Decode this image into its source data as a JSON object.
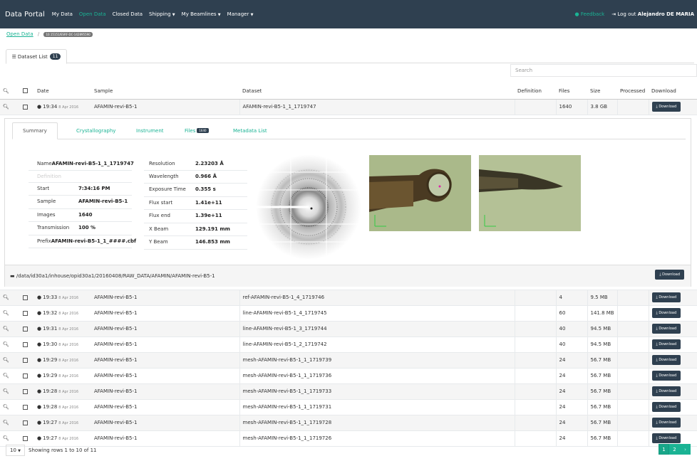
{
  "nav": {
    "brand": "Data Portal",
    "items": [
      {
        "label": "My Data",
        "active": false,
        "dropdown": false
      },
      {
        "label": "Open Data",
        "active": true,
        "dropdown": false
      },
      {
        "label": "Closed Data",
        "active": false,
        "dropdown": false
      },
      {
        "label": "Shipping",
        "active": false,
        "dropdown": true
      },
      {
        "label": "My Beamlines",
        "active": false,
        "dropdown": true
      },
      {
        "label": "Manager",
        "active": false,
        "dropdown": true
      }
    ],
    "feedback": "Feedback",
    "logout": "Log out",
    "user": "Alejandro DE MARIA"
  },
  "breadcrumb": {
    "root": "Open Data",
    "separator": "/",
    "doi": "10.15151/ESRF-DC-142895590"
  },
  "dataset_tab": {
    "label": "Dataset List",
    "count": "11"
  },
  "search": {
    "placeholder": "Search"
  },
  "table": {
    "headers": {
      "date": "Date",
      "sample": "Sample",
      "dataset": "Dataset",
      "definition": "Definition",
      "files": "Files",
      "size": "Size",
      "processed": "Processed",
      "download": "Download"
    },
    "download_label": "Download",
    "expanded_row": {
      "time": "19:34",
      "date": "8 Apr 2016",
      "sample": "AFAMIN-revi-B5-1",
      "dataset": "AFAMIN-revi-B5-1_1_1719747",
      "definition": "",
      "files": "1640",
      "size": "3.8 GB"
    },
    "rows": [
      {
        "time": "19:33",
        "date": "8 Apr 2016",
        "sample": "AFAMIN-revi-B5-1",
        "dataset": "ref-AFAMIN-revi-B5-1_4_1719746",
        "files": "4",
        "size": "9.5 MB"
      },
      {
        "time": "19:32",
        "date": "8 Apr 2016",
        "sample": "AFAMIN-revi-B5-1",
        "dataset": "line-AFAMIN-revi-B5-1_4_1719745",
        "files": "60",
        "size": "141.8 MB"
      },
      {
        "time": "19:31",
        "date": "8 Apr 2016",
        "sample": "AFAMIN-revi-B5-1",
        "dataset": "line-AFAMIN-revi-B5-1_3_1719744",
        "files": "40",
        "size": "94.5 MB"
      },
      {
        "time": "19:30",
        "date": "8 Apr 2016",
        "sample": "AFAMIN-revi-B5-1",
        "dataset": "line-AFAMIN-revi-B5-1_2_1719742",
        "files": "40",
        "size": "94.5 MB"
      },
      {
        "time": "19:29",
        "date": "8 Apr 2016",
        "sample": "AFAMIN-revi-B5-1",
        "dataset": "mesh-AFAMIN-revi-B5-1_1_1719739",
        "files": "24",
        "size": "56.7 MB"
      },
      {
        "time": "19:29",
        "date": "8 Apr 2016",
        "sample": "AFAMIN-revi-B5-1",
        "dataset": "mesh-AFAMIN-revi-B5-1_1_1719736",
        "files": "24",
        "size": "56.7 MB"
      },
      {
        "time": "19:28",
        "date": "8 Apr 2016",
        "sample": "AFAMIN-revi-B5-1",
        "dataset": "mesh-AFAMIN-revi-B5-1_1_1719733",
        "files": "24",
        "size": "56.7 MB"
      },
      {
        "time": "19:28",
        "date": "8 Apr 2016",
        "sample": "AFAMIN-revi-B5-1",
        "dataset": "mesh-AFAMIN-revi-B5-1_1_1719731",
        "files": "24",
        "size": "56.7 MB"
      },
      {
        "time": "19:27",
        "date": "8 Apr 2016",
        "sample": "AFAMIN-revi-B5-1",
        "dataset": "mesh-AFAMIN-revi-B5-1_1_1719728",
        "files": "24",
        "size": "56.7 MB"
      },
      {
        "time": "19:27",
        "date": "8 Apr 2016",
        "sample": "AFAMIN-revi-B5-1",
        "dataset": "mesh-AFAMIN-revi-B5-1_1_1719726",
        "files": "24",
        "size": "56.7 MB"
      }
    ]
  },
  "detail": {
    "tabs": {
      "summary": "Summary",
      "crystallography": "Crystallography",
      "instrument": "Instrument",
      "files": "Files",
      "files_count": "1640",
      "metadata": "Metadata List"
    },
    "left": [
      {
        "label": "Name",
        "value": "AFAMIN-revi-B5-1_1_1719747",
        "muted": false
      },
      {
        "label": "Definition",
        "value": "",
        "muted": true
      },
      {
        "label": "Start",
        "value": "7:34:16 PM",
        "muted": false
      },
      {
        "label": "Sample",
        "value": "AFAMIN-revi-B5-1",
        "muted": false
      },
      {
        "label": "Images",
        "value": "1640",
        "muted": false
      },
      {
        "label": "Transmission",
        "value": "100 %",
        "muted": false
      },
      {
        "label": "Prefix",
        "value": "AFAMIN-revi-B5-1_1_####.cbf",
        "muted": false
      }
    ],
    "right": [
      {
        "label": "Resolution",
        "value": "2.23203 Å"
      },
      {
        "label": "Wavelength",
        "value": "0.966 Å"
      },
      {
        "label": "Exposure Time",
        "value": "0.355 s"
      },
      {
        "label": "Flux start",
        "value": "1.41e+11"
      },
      {
        "label": "Flux end",
        "value": "1.39e+11"
      },
      {
        "label": "X Beam",
        "value": "129.191 mm"
      },
      {
        "label": "Y Beam",
        "value": "146.853 mm"
      }
    ],
    "path": "/data/id30a1/inhouse/opid30a1/20160408/RAW_DATA/AFAMIN/AFAMIN-revi-B5-1"
  },
  "footer": {
    "page_size": "10",
    "showing": "Showing rows 1 to 10 of 11",
    "pages": [
      "1",
      "2"
    ],
    "current_page": "1",
    "next": "›"
  },
  "colors": {
    "navbar": "#2f4050",
    "accent": "#1ab394",
    "button": "#2f4050"
  },
  "icons": [
    "magnifier-icon",
    "clock-icon",
    "checkbox-icon",
    "download-icon",
    "folder-icon",
    "list-icon",
    "comment-icon",
    "logout-icon"
  ]
}
